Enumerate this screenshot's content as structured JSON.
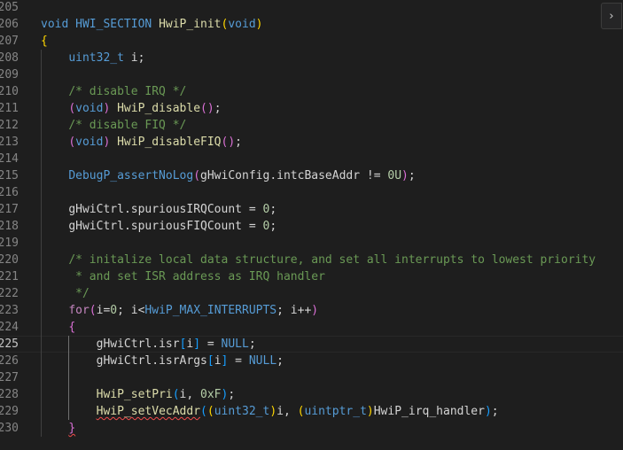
{
  "colors": {
    "background": "#1e1e1e",
    "keyword": "#569cd6",
    "control": "#c586c0",
    "type": "#4ec9b0",
    "function": "#dcdcaa",
    "variable": "#9cdcfe",
    "number": "#b5cea8",
    "comment": "#6a9955",
    "bracket_level_1": "#ffd700",
    "bracket_level_2": "#da70d6",
    "bracket_level_3": "#179fff",
    "error_squiggle": "#f14c4c"
  },
  "editor": {
    "current_line": 225,
    "collapse_icon": "chevron-right-icon",
    "collapse_glyph": "›",
    "lines": [
      {
        "number": 205,
        "tokens": []
      },
      {
        "number": 206,
        "tokens": [
          {
            "t": "void",
            "c": "kw"
          },
          {
            "t": " ",
            "c": "plain"
          },
          {
            "t": "HWI_SECTION",
            "c": "macro"
          },
          {
            "t": " ",
            "c": "plain"
          },
          {
            "t": "HwiP_init",
            "c": "fn"
          },
          {
            "t": "(",
            "c": "br1"
          },
          {
            "t": "void",
            "c": "kw"
          },
          {
            "t": ")",
            "c": "br1"
          }
        ]
      },
      {
        "number": 207,
        "tokens": [
          {
            "t": "{",
            "c": "br1"
          }
        ]
      },
      {
        "number": 208,
        "tokens": [
          {
            "t": "    ",
            "c": "plain"
          },
          {
            "t": "uint32_t",
            "c": "kw"
          },
          {
            "t": " ",
            "c": "plain"
          },
          {
            "t": "i",
            "c": "plain"
          },
          {
            "t": ";",
            "c": "plain"
          }
        ]
      },
      {
        "number": 209,
        "tokens": []
      },
      {
        "number": 210,
        "tokens": [
          {
            "t": "    ",
            "c": "plain"
          },
          {
            "t": "/* disable IRQ */",
            "c": "cmt"
          }
        ]
      },
      {
        "number": 211,
        "tokens": [
          {
            "t": "    ",
            "c": "plain"
          },
          {
            "t": "(",
            "c": "br2"
          },
          {
            "t": "void",
            "c": "kw"
          },
          {
            "t": ")",
            "c": "br2"
          },
          {
            "t": " ",
            "c": "plain"
          },
          {
            "t": "HwiP_disable",
            "c": "fn"
          },
          {
            "t": "(",
            "c": "br2"
          },
          {
            "t": ")",
            "c": "br2"
          },
          {
            "t": ";",
            "c": "plain"
          }
        ]
      },
      {
        "number": 212,
        "tokens": [
          {
            "t": "    ",
            "c": "plain"
          },
          {
            "t": "/* disable FIQ */",
            "c": "cmt"
          }
        ]
      },
      {
        "number": 213,
        "tokens": [
          {
            "t": "    ",
            "c": "plain"
          },
          {
            "t": "(",
            "c": "br2"
          },
          {
            "t": "void",
            "c": "kw"
          },
          {
            "t": ")",
            "c": "br2"
          },
          {
            "t": " ",
            "c": "plain"
          },
          {
            "t": "HwiP_disableFIQ",
            "c": "fn"
          },
          {
            "t": "(",
            "c": "br2"
          },
          {
            "t": ")",
            "c": "br2"
          },
          {
            "t": ";",
            "c": "plain"
          }
        ]
      },
      {
        "number": 214,
        "tokens": []
      },
      {
        "number": 215,
        "tokens": [
          {
            "t": "    ",
            "c": "plain"
          },
          {
            "t": "DebugP_assertNoLog",
            "c": "macro"
          },
          {
            "t": "(",
            "c": "br2"
          },
          {
            "t": "gHwiConfig",
            "c": "plain"
          },
          {
            "t": ".",
            "c": "plain"
          },
          {
            "t": "intcBaseAddr",
            "c": "plain"
          },
          {
            "t": " != ",
            "c": "plain"
          },
          {
            "t": "0U",
            "c": "num"
          },
          {
            "t": ")",
            "c": "br2"
          },
          {
            "t": ";",
            "c": "plain"
          }
        ]
      },
      {
        "number": 216,
        "tokens": []
      },
      {
        "number": 217,
        "tokens": [
          {
            "t": "    ",
            "c": "plain"
          },
          {
            "t": "gHwiCtrl",
            "c": "plain"
          },
          {
            "t": ".",
            "c": "plain"
          },
          {
            "t": "spuriousIRQCount",
            "c": "plain"
          },
          {
            "t": " = ",
            "c": "plain"
          },
          {
            "t": "0",
            "c": "num"
          },
          {
            "t": ";",
            "c": "plain"
          }
        ]
      },
      {
        "number": 218,
        "tokens": [
          {
            "t": "    ",
            "c": "plain"
          },
          {
            "t": "gHwiCtrl",
            "c": "plain"
          },
          {
            "t": ".",
            "c": "plain"
          },
          {
            "t": "spuriousFIQCount",
            "c": "plain"
          },
          {
            "t": " = ",
            "c": "plain"
          },
          {
            "t": "0",
            "c": "num"
          },
          {
            "t": ";",
            "c": "plain"
          }
        ]
      },
      {
        "number": 219,
        "tokens": []
      },
      {
        "number": 220,
        "tokens": [
          {
            "t": "    ",
            "c": "plain"
          },
          {
            "t": "/* initalize local data structure, and set all interrupts to lowest priority",
            "c": "cmt"
          }
        ]
      },
      {
        "number": 221,
        "tokens": [
          {
            "t": "     ",
            "c": "plain"
          },
          {
            "t": "* and set ISR address as IRQ handler",
            "c": "cmt"
          }
        ]
      },
      {
        "number": 222,
        "tokens": [
          {
            "t": "     ",
            "c": "plain"
          },
          {
            "t": "*/",
            "c": "cmt"
          }
        ]
      },
      {
        "number": 223,
        "tokens": [
          {
            "t": "    ",
            "c": "plain"
          },
          {
            "t": "for",
            "c": "ctrl"
          },
          {
            "t": "(",
            "c": "br2"
          },
          {
            "t": "i",
            "c": "plain"
          },
          {
            "t": "=",
            "c": "plain"
          },
          {
            "t": "0",
            "c": "num"
          },
          {
            "t": "; ",
            "c": "plain"
          },
          {
            "t": "i",
            "c": "plain"
          },
          {
            "t": "<",
            "c": "plain"
          },
          {
            "t": "HwiP_MAX_INTERRUPTS",
            "c": "macro"
          },
          {
            "t": "; ",
            "c": "plain"
          },
          {
            "t": "i",
            "c": "plain"
          },
          {
            "t": "++",
            "c": "plain"
          },
          {
            "t": ")",
            "c": "br2"
          }
        ]
      },
      {
        "number": 224,
        "tokens": [
          {
            "t": "    ",
            "c": "plain"
          },
          {
            "t": "{",
            "c": "br2"
          }
        ]
      },
      {
        "number": 225,
        "tokens": [
          {
            "t": "        ",
            "c": "plain"
          },
          {
            "t": "gHwiCtrl",
            "c": "plain"
          },
          {
            "t": ".",
            "c": "plain"
          },
          {
            "t": "isr",
            "c": "plain"
          },
          {
            "t": "[",
            "c": "br3"
          },
          {
            "t": "i",
            "c": "plain"
          },
          {
            "t": "]",
            "c": "br3"
          },
          {
            "t": " = ",
            "c": "plain"
          },
          {
            "t": "NULL",
            "c": "const"
          },
          {
            "t": ";",
            "c": "plain"
          }
        ]
      },
      {
        "number": 226,
        "tokens": [
          {
            "t": "        ",
            "c": "plain"
          },
          {
            "t": "gHwiCtrl",
            "c": "plain"
          },
          {
            "t": ".",
            "c": "plain"
          },
          {
            "t": "isrArgs",
            "c": "plain"
          },
          {
            "t": "[",
            "c": "br3"
          },
          {
            "t": "i",
            "c": "plain"
          },
          {
            "t": "]",
            "c": "br3"
          },
          {
            "t": " = ",
            "c": "plain"
          },
          {
            "t": "NULL",
            "c": "const"
          },
          {
            "t": ";",
            "c": "plain"
          }
        ]
      },
      {
        "number": 227,
        "tokens": []
      },
      {
        "number": 228,
        "tokens": [
          {
            "t": "        ",
            "c": "plain"
          },
          {
            "t": "HwiP_setPri",
            "c": "fn"
          },
          {
            "t": "(",
            "c": "br3"
          },
          {
            "t": "i",
            "c": "plain"
          },
          {
            "t": ", ",
            "c": "plain"
          },
          {
            "t": "0xF",
            "c": "num"
          },
          {
            "t": ")",
            "c": "br3"
          },
          {
            "t": ";",
            "c": "plain"
          }
        ]
      },
      {
        "number": 229,
        "tokens": [
          {
            "t": "        ",
            "c": "plain"
          },
          {
            "t": "HwiP_setVecAddr",
            "c": "fn",
            "squiggle": true
          },
          {
            "t": "(",
            "c": "br3"
          },
          {
            "t": "(",
            "c": "br1"
          },
          {
            "t": "uint32_t",
            "c": "kw"
          },
          {
            "t": ")",
            "c": "br1"
          },
          {
            "t": "i",
            "c": "plain"
          },
          {
            "t": ", ",
            "c": "plain"
          },
          {
            "t": "(",
            "c": "br1"
          },
          {
            "t": "uintptr_t",
            "c": "kw"
          },
          {
            "t": ")",
            "c": "br1"
          },
          {
            "t": "HwiP_irq_handler",
            "c": "plain"
          },
          {
            "t": ")",
            "c": "br3"
          },
          {
            "t": ";",
            "c": "plain"
          }
        ]
      },
      {
        "number": 230,
        "tokens": [
          {
            "t": "    ",
            "c": "plain"
          },
          {
            "t": "}",
            "c": "br2",
            "squiggle": true
          }
        ]
      }
    ]
  }
}
